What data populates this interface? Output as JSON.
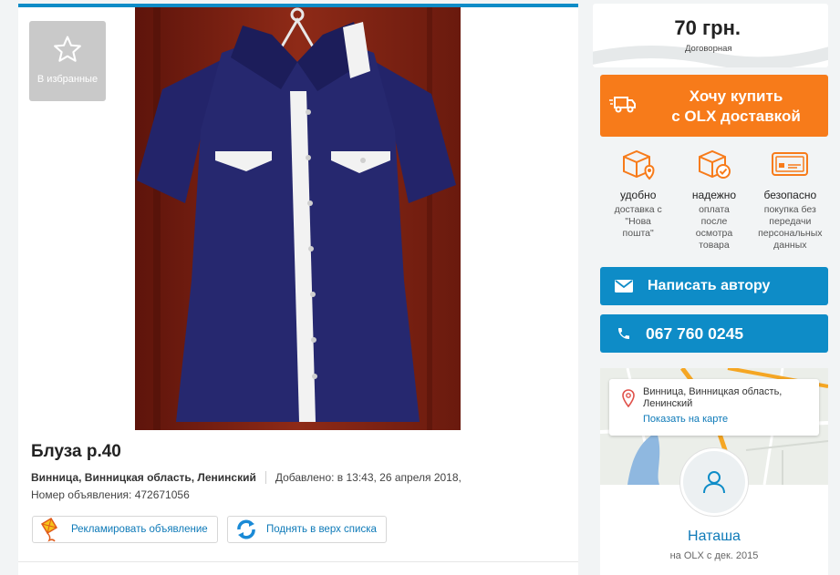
{
  "favorites": {
    "label": "В избранные",
    "icon": "star-icon"
  },
  "listing": {
    "title": "Блуза р.40",
    "location": "Винница, Винницкая область, Ленинский",
    "added": "Добавлено: в 13:43, 26 апреля 2018,",
    "ad_number": "Номер объявления: 472671056"
  },
  "actions": {
    "promote": "Рекламировать объявление",
    "raise": "Поднять в верх списка"
  },
  "price": {
    "value": "70 грн.",
    "note": "Договорная"
  },
  "buy": {
    "line1": "Хочу купить",
    "line2": "с OLX доставкой"
  },
  "features": [
    {
      "icon": "box-location-icon",
      "title": "удобно",
      "desc": "доставка с \"Нова пошта\""
    },
    {
      "icon": "box-check-icon",
      "title": "надежно",
      "desc": "оплата после осмотра товара"
    },
    {
      "icon": "card-icon",
      "title": "безопасно",
      "desc": "покупка без передачи персональных данных"
    }
  ],
  "contact": {
    "message": "Написать автору",
    "phone": "067 760 0245"
  },
  "map": {
    "address": "Винница, Винницкая область, Ленинский",
    "show_link": "Показать на карте"
  },
  "user": {
    "name": "Наташа",
    "since": "на OLX с дек. 2015"
  },
  "colors": {
    "accent_blue": "#0e8cc7",
    "orange": "#f77b1a",
    "garment_navy": "#23246a"
  }
}
